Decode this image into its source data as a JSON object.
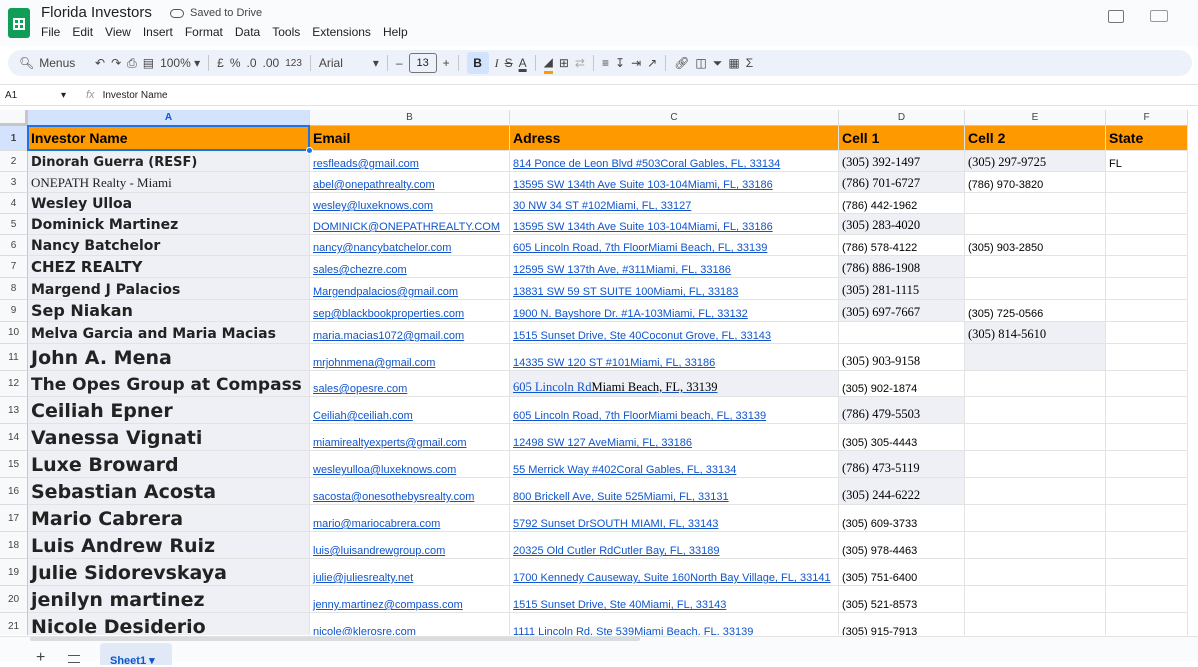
{
  "app": {
    "title": "Florida Investors",
    "save_status": "Saved to Drive",
    "menus": [
      "File",
      "Edit",
      "View",
      "Insert",
      "Format",
      "Data",
      "Tools",
      "Extensions",
      "Help"
    ]
  },
  "toolbar": {
    "search_label": "Menus",
    "zoom": "100%",
    "currency": "£",
    "percent": "%",
    "dec_decrease": ".0",
    "dec_increase": ".00",
    "number_format": "123",
    "font": "Arial",
    "font_size": "13",
    "minus": "–",
    "plus": "+",
    "bold": "B",
    "italic": "I",
    "strike": "S",
    "text_color": "A",
    "sum": "Σ"
  },
  "formula_bar": {
    "cell_ref": "A1",
    "content": "Investor Name"
  },
  "colors": {
    "header_fill": "#ff9900",
    "link": "#1155cc",
    "selection": "#1a73e8"
  },
  "columns": [
    "A",
    "B",
    "C",
    "D",
    "E",
    "F"
  ],
  "headers": [
    "Investor Name",
    "Email",
    "Adress",
    "Cell 1",
    "Cell 2",
    "State"
  ],
  "rows": [
    {
      "num": "2",
      "name": "Dinorah Guerra (RESF)",
      "email": "resfleads@gmail.com",
      "address": "814 Ponce de Leon Blvd #503Coral Gables, FL, 33134",
      "cell1": "(305) 392-1497",
      "cell2": "(305) 297-9725",
      "state": "FL"
    },
    {
      "num": "3",
      "name": "ONEPATH Realty - Miami",
      "email": "abel@onepathrealty.com",
      "address": "13595 SW 134th Ave Suite 103-104Miami, FL, 33186",
      "cell1": "(786) 701-6727",
      "cell2": "(786) 970-3820",
      "state": ""
    },
    {
      "num": "4",
      "name": "Wesley Ulloa",
      "email": "wesley@luxeknows.com",
      "address": "30 NW 34 ST #102Miami, FL, 33127",
      "cell1": "(786) 442-1962",
      "cell2": "",
      "state": ""
    },
    {
      "num": "5",
      "name": "Dominick Martinez",
      "email": "DOMINICK@ONEPATHREALTY.COM",
      "address": "13595 SW 134th Ave Suite 103-104Miami, FL, 33186",
      "cell1": "(305) 283-4020",
      "cell2": "",
      "state": ""
    },
    {
      "num": "6",
      "name": "Nancy Batchelor",
      "email": "nancy@nancybatchelor.com",
      "address": "605 Lincoln Road, 7th FloorMiami Beach, FL, 33139",
      "cell1": "(786) 578-4122",
      "cell2": "(305) 903-2850",
      "state": ""
    },
    {
      "num": "7",
      "name": "CHEZ REALTY",
      "email": "sales@chezre.com",
      "address": "12595 SW 137th Ave, #311Miami, FL, 33186",
      "cell1": "(786) 886-1908",
      "cell2": "",
      "state": ""
    },
    {
      "num": "8",
      "name": "Margend J Palacios",
      "email": "Margendpalacios@gmail.com",
      "address": "13831 SW 59 ST SUITE 100Miami, FL, 33183",
      "cell1": "(305) 281-1115",
      "cell2": "",
      "state": ""
    },
    {
      "num": "9",
      "name": "Sep Niakan",
      "email": "sep@blackbookproperties.com",
      "address": "1900 N. Bayshore Dr. #1A-103Miami, FL, 33132",
      "cell1": "(305) 697-7667",
      "cell2": "(305) 725-0566",
      "state": ""
    },
    {
      "num": "10",
      "name": "Melva Garcia and Maria Macias",
      "email": "maria.macias1072@gmail.com",
      "address": "1515 Sunset Drive, Ste 40Coconut Grove, FL, 33143",
      "cell1": "",
      "cell2": "(305) 814-5610",
      "state": ""
    },
    {
      "num": "11",
      "name": "John A. Mena",
      "email": "mrjohnmena@gmail.com",
      "address": "14335 SW 120 ST #101Miami, FL, 33186",
      "cell1": "(305) 903-9158",
      "cell2": "",
      "state": ""
    },
    {
      "num": "12",
      "name": "The Opes Group at Compass",
      "email": "sales@opesre.com",
      "address_a": "605 Lincoln Rd",
      "address_b": "Miami Beach, FL, 33139",
      "cell1": "(305) 902-1874",
      "cell2": "",
      "state": ""
    },
    {
      "num": "13",
      "name": "Ceiliah Epner",
      "email": "Ceiliah@ceiliah.com",
      "address": "605 Lincoln Road, 7th FloorMiami beach, FL, 33139",
      "cell1": "(786) 479-5503",
      "cell2": "",
      "state": ""
    },
    {
      "num": "14",
      "name": "Vanessa Vignati",
      "email": "miamirealtyexperts@gmail.com",
      "address": "12498 SW 127 AveMiami, FL, 33186",
      "cell1": "(305) 305-4443",
      "cell2": "",
      "state": ""
    },
    {
      "num": "15",
      "name": "Luxe Broward",
      "email": "wesleyulloa@luxeknows.com",
      "address": "55 Merrick Way #402Coral Gables, FL, 33134",
      "cell1": "(786) 473-5119",
      "cell2": "",
      "state": ""
    },
    {
      "num": "16",
      "name": "Sebastian Acosta",
      "email": "sacosta@onesothebysrealty.com",
      "address": "800 Brickell Ave, Suite 525Miami, FL, 33131",
      "cell1": "(305) 244-6222",
      "cell2": "",
      "state": ""
    },
    {
      "num": "17",
      "name": "Mario Cabrera",
      "email": "mario@mariocabrera.com",
      "address": "5792 Sunset DrSOUTH MIAMI, FL, 33143",
      "cell1": "(305) 609-3733",
      "cell2": "",
      "state": ""
    },
    {
      "num": "18",
      "name": "Luis Andrew Ruiz",
      "email": "luis@luisandrewgroup.com",
      "address": "20325 Old Cutler RdCutler Bay, FL, 33189",
      "cell1": "(305) 978-4463",
      "cell2": "",
      "state": ""
    },
    {
      "num": "19",
      "name": "Julie Sidorevskaya",
      "email": "julie@juliesrealty.net",
      "address": "1700 Kennedy Causeway, Suite 160North Bay Village, FL, 33141",
      "cell1": "(305) 751-6400",
      "cell2": "",
      "state": ""
    },
    {
      "num": "20",
      "name": "jenilyn martinez",
      "email": "jenny.martinez@compass.com",
      "address": "1515 Sunset Drive, Ste 40Miami, FL, 33143",
      "cell1": "(305) 521-8573",
      "cell2": "",
      "state": ""
    },
    {
      "num": "21",
      "name": "Nicole Desiderio",
      "email": "nicole@klerosre.com",
      "address": "1111 Lincoln Rd, Ste 539Miami Beach, FL, 33139",
      "cell1": "(305) 915-7913",
      "cell2": "",
      "state": ""
    }
  ],
  "sheet": {
    "add": "+",
    "tab_label": "Sheet1"
  }
}
